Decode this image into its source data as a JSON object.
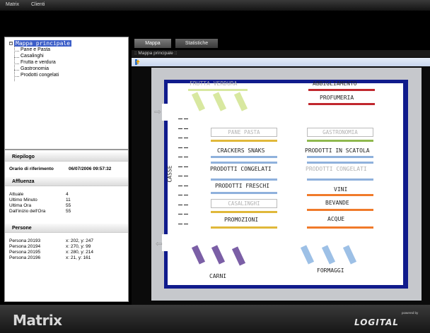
{
  "menu": {
    "items": [
      "Matrix",
      "Clienti"
    ]
  },
  "tree": {
    "root": "Mappa principale",
    "children": [
      "Pane e Pasta",
      "Casalinghi",
      "Frutta e verdura",
      "Gastronomia",
      "Prodotti congelati"
    ]
  },
  "riepilogo": {
    "title": "Riepilogo",
    "orario_label": "Orario di riferimento",
    "orario_value": "06/07/2006 09:57:32"
  },
  "affluenza": {
    "title": "Affluenza",
    "rows": [
      {
        "label": "Attuale",
        "value": "4"
      },
      {
        "label": "Ultimo Minuto",
        "value": "11"
      },
      {
        "label": "Ultima Ora",
        "value": "55"
      },
      {
        "label": "Dall'inizio dell'Ora",
        "value": "55"
      }
    ]
  },
  "persone": {
    "title": "Persone",
    "rows": [
      {
        "label": "Persona 20193",
        "value": "x: 202, y: 247"
      },
      {
        "label": "Persona 20194",
        "value": "x: 270, y: 99"
      },
      {
        "label": "Persona 20195",
        "value": "x: 280, y: 214"
      },
      {
        "label": "Persona 20196",
        "value": "x: 21, y: 161"
      }
    ]
  },
  "tabs": {
    "mappa": "Mappa",
    "statistiche": "Statistiche"
  },
  "breadcrumb": ":: Mappa principale ::",
  "map": {
    "frutta_verdura": "FRUTTA VERDURA",
    "abbigliamento": "ABBIGLIAMENTO",
    "profumeria": "PROFUMERIA",
    "pane_pasta": "PANE PASTA",
    "gastronomia": "GASTRONOMIA",
    "crackers": "CRACKERS SNAKS",
    "prodotti_scatola": "PRODOTTI IN SCATOLA",
    "prodotti_congelati": "PRODOTTI CONGELATI",
    "prodotti_congelati_2": "PRODOTTI CONGELATI",
    "prodotti_freschi": "PRODOTTI FRESCHI",
    "vini": "VINI",
    "casalinghi": "CASALINGHI",
    "bevande": "BEVANDE",
    "promozioni": "PROMOZIONI",
    "acque": "ACQUE",
    "casse": "CASSE",
    "carni": "CARNI",
    "formaggi": "FORMAGGI"
  },
  "colors": {
    "wall": "#101b8c",
    "red": "#c0272d",
    "blue": "#8fb1dc",
    "orange": "#f07a2a",
    "yellow": "#e0b83a",
    "purple": "#7b5fa6",
    "lightblue": "#9dc0e6",
    "green": "#d8e8a0"
  },
  "footer": {
    "logo": "Matrix",
    "powered": "powered by",
    "brand": "LOGITAL"
  }
}
